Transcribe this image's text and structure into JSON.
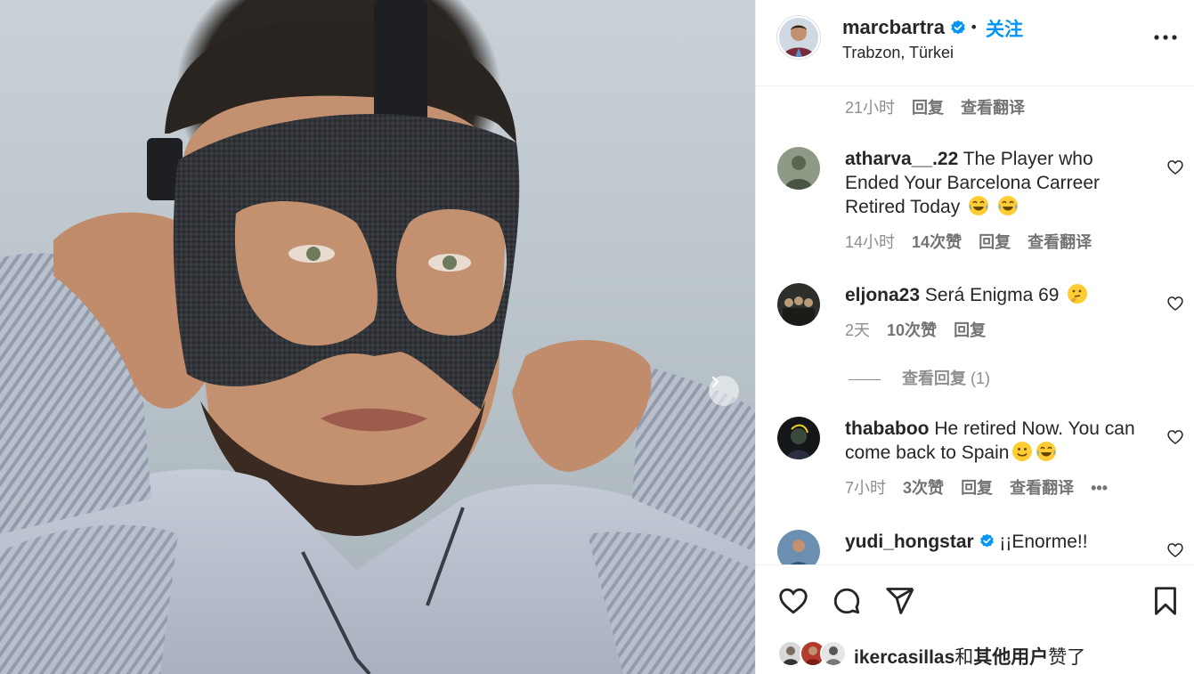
{
  "post": {
    "username": "marcbartra",
    "verified": true,
    "separator": "•",
    "follow_label": "关注",
    "location": "Trabzon, Türkei"
  },
  "top_meta": {
    "time": "21小时",
    "reply_label": "回复",
    "translate_label": "查看翻译"
  },
  "comments": [
    {
      "username": "atharva__.22",
      "text": "The Player who Ended Your Barcelona Carreer Retired Today",
      "emoji": [
        "face-with-tears-of-joy",
        "face-with-tears-of-joy"
      ],
      "time": "14小时",
      "likes": "14次赞",
      "reply_label": "回复",
      "translate_label": "查看翻译"
    },
    {
      "username": "eljona23",
      "text": "Será Enigma 69",
      "emoji": [
        "thinking-face"
      ],
      "time": "2天",
      "likes": "10次赞",
      "reply_label": "回复",
      "view_replies": "查看回复",
      "view_replies_count": "(1)"
    },
    {
      "username": "thababoo",
      "text": "He retired Now. You can come back to Spain",
      "emoji": [
        "slightly-smiling-face",
        "face-with-tears-of-joy"
      ],
      "time": "7小时",
      "likes": "3次赞",
      "reply_label": "回复",
      "translate_label": "查看翻译",
      "more_label": "•••"
    },
    {
      "username": "yudi_hongstar",
      "verified": true,
      "text": "¡¡Enorme!!"
    }
  ],
  "likes_summary": {
    "user": "ikercasillas",
    "connector": "和",
    "others": "其他用户",
    "suffix": "赞了"
  },
  "icons": {
    "like": "heart-icon",
    "comment": "comment-icon",
    "share": "paper-plane-icon",
    "save": "bookmark-icon",
    "options": "more-horizontal-icon",
    "next": "chevron-right-icon"
  },
  "colors": {
    "accent": "#0095f6",
    "text": "#262626",
    "muted": "#8e8e8e",
    "divider": "#efefef"
  }
}
